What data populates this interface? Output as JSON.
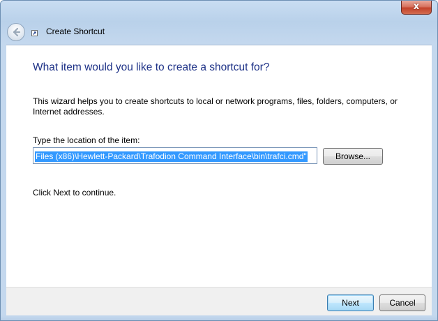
{
  "window": {
    "title": "Create Shortcut",
    "close_glyph": "x",
    "icons": {
      "back": "back-arrow-icon",
      "shortcut": "shortcut-icon",
      "close": "close-icon"
    }
  },
  "main": {
    "heading": "What item would you like to create a shortcut for?",
    "description": "This wizard helps you to create shortcuts to local or network programs, files, folders, computers, or Internet addresses.",
    "location_label": "Type the location of the item:",
    "location_value": "Files (x86)\\Hewlett-Packard\\Trafodion Command Interface\\bin\\trafci.cmd\"",
    "browse_label": "Browse...",
    "continue_text": "Click Next to continue."
  },
  "footer": {
    "next_label": "Next",
    "cancel_label": "Cancel"
  },
  "colors": {
    "heading": "#1e3287",
    "selection": "#3399ff",
    "frame": "#c4d8ee"
  }
}
